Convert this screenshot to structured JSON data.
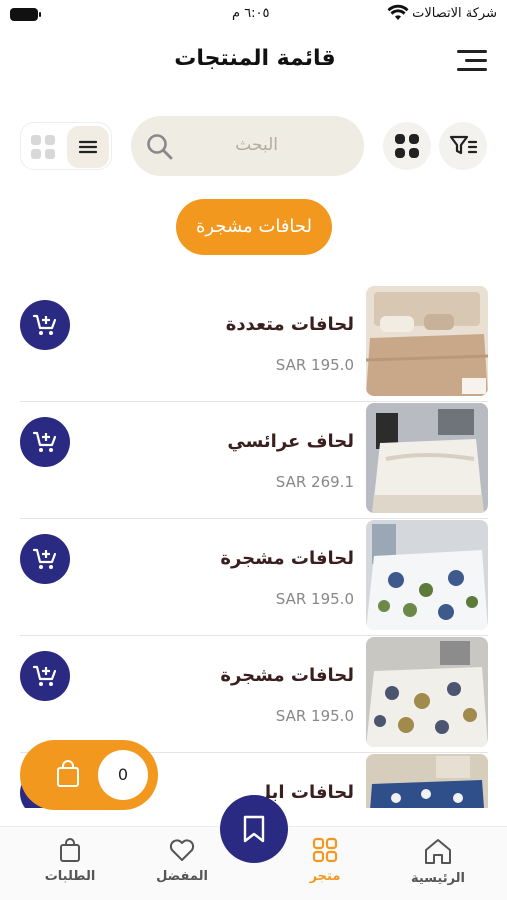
{
  "status_bar": {
    "carrier": "شركة الاتصالات",
    "time": "٦:٠٥ م"
  },
  "header": {
    "title": "قائمة المنتجات"
  },
  "search": {
    "placeholder": "البحث"
  },
  "category_chip": "لحافات مشجرة",
  "products": [
    {
      "name": "لحافات متعددة",
      "price": "SAR 195.0",
      "image": "beige-comforter"
    },
    {
      "name": "لحاف عرائسي",
      "price": "SAR 269.1",
      "image": "white-bridal-comforter"
    },
    {
      "name": "لحافات مشجرة",
      "price": "SAR 195.0",
      "image": "floral-comforter"
    },
    {
      "name": "لحافات مشجرة",
      "price": "SAR 195.0",
      "image": "floral-comforter"
    },
    {
      "name": "لحافات ابل",
      "price": "",
      "image": "blue-comforter"
    }
  ],
  "cart_pill": {
    "count": "0"
  },
  "bottom_nav": {
    "home": "الرئيسية",
    "store": "متجر",
    "favorites": "المفضل",
    "orders": "الطلبات"
  },
  "colors": {
    "accent": "#f3981f",
    "primary": "#2a2a83",
    "search_bg": "#efece3"
  }
}
